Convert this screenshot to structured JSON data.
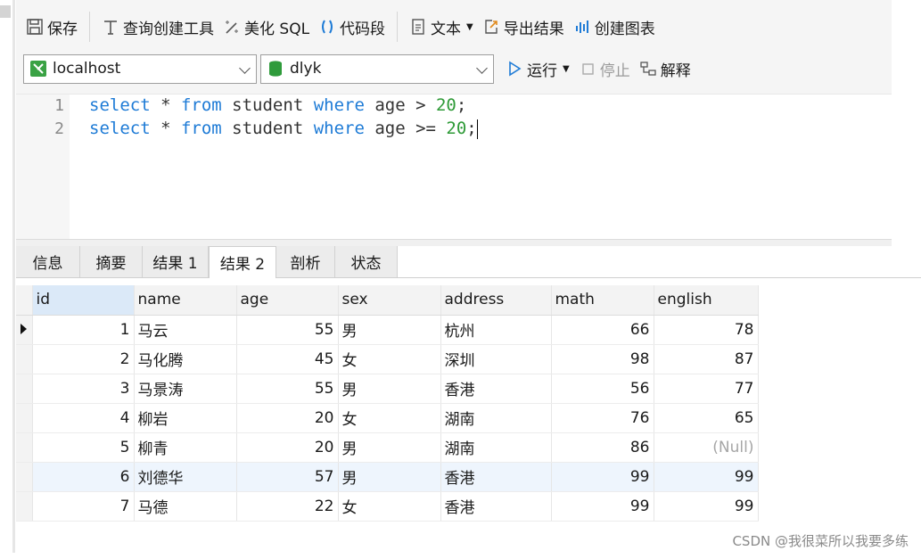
{
  "toolbar": {
    "save": "保存",
    "query_builder": "查询创建工具",
    "beautify_sql": "美化 SQL",
    "code_snippet": "代码段",
    "text": "文本",
    "export_results": "导出结果",
    "create_chart": "创建图表",
    "run": "运行",
    "stop": "停止",
    "explain": "解释"
  },
  "connection": {
    "selected": "localhost"
  },
  "database": {
    "selected": "dlyk"
  },
  "editor": {
    "line_numbers": [
      "1",
      "2"
    ]
  },
  "tabs": [
    {
      "label": "信息"
    },
    {
      "label": "摘要"
    },
    {
      "label": "结果 1"
    },
    {
      "label": "结果 2",
      "active": true
    },
    {
      "label": "剖析"
    },
    {
      "label": "状态"
    }
  ],
  "result": {
    "columns": [
      "id",
      "name",
      "age",
      "sex",
      "address",
      "math",
      "english"
    ],
    "rows": [
      [
        "1",
        "马云",
        "55",
        "男",
        "杭州",
        "66",
        "78"
      ],
      [
        "2",
        "马化腾",
        "45",
        "女",
        "深圳",
        "98",
        "87"
      ],
      [
        "3",
        "马景涛",
        "55",
        "男",
        "香港",
        "56",
        "77"
      ],
      [
        "4",
        "柳岩",
        "20",
        "女",
        "湖南",
        "76",
        "65"
      ],
      [
        "5",
        "柳青",
        "20",
        "男",
        "湖南",
        "86",
        "(Null)"
      ],
      [
        "6",
        "刘德华",
        "57",
        "男",
        "香港",
        "99",
        "99"
      ],
      [
        "7",
        "马德",
        "22",
        "女",
        "香港",
        "99",
        "99"
      ]
    ]
  },
  "watermark": "CSDN @我很菜所以我要多练",
  "colors": {
    "keyword": "#1e7bd6",
    "number": "#2e9a37",
    "selected_header": "#dbe9f8",
    "null_text": "#a6a6a6"
  }
}
